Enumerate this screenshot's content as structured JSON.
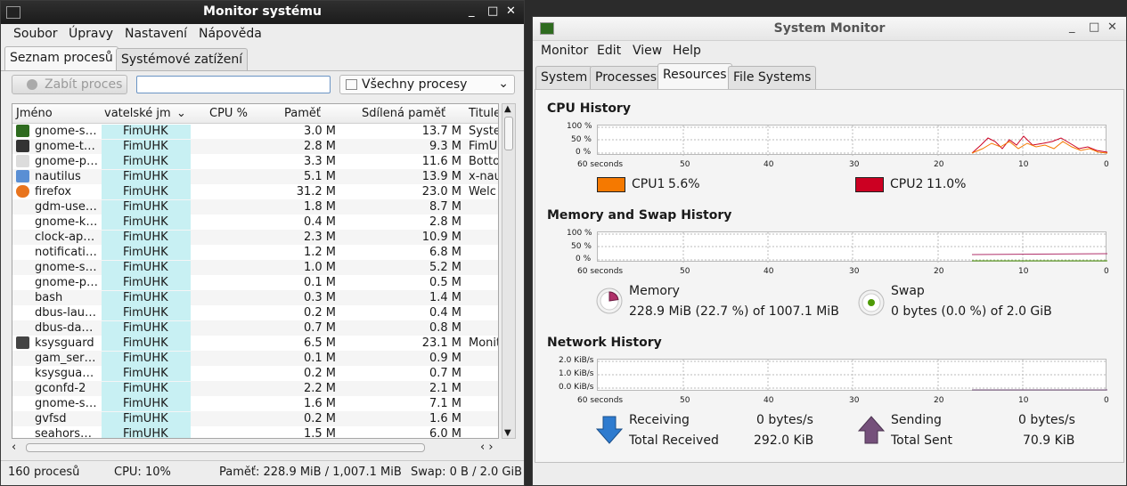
{
  "left_window": {
    "title": "Monitor systému",
    "menu": [
      "Soubor",
      "Úpravy",
      "Nastavení",
      "Nápověda"
    ],
    "tabs": [
      "Seznam procesů",
      "Systémové zatížení"
    ],
    "kill_button": "Zabít proces",
    "search_value": "",
    "filter_value": "Všechny procesy",
    "columns": [
      "Jméno",
      "vatelské jm",
      "CPU %",
      "Paměť",
      "Sdílená paměť",
      "Titule"
    ],
    "processes": [
      {
        "name": "gnome-s…",
        "user": "FimUHK",
        "mem": "3.0 M",
        "shared": "13.7 M",
        "title": "Syste",
        "icon": "monitor-icon"
      },
      {
        "name": "gnome-t…",
        "user": "FimUHK",
        "mem": "2.8 M",
        "shared": "9.3 M",
        "title": "FimU",
        "icon": "terminal-icon"
      },
      {
        "name": "gnome-p…",
        "user": "FimUHK",
        "mem": "3.3 M",
        "shared": "11.6 M",
        "title": "Botto",
        "icon": "panel-icon"
      },
      {
        "name": "nautilus",
        "user": "FimUHK",
        "mem": "5.1 M",
        "shared": "13.9 M",
        "title": "x-nau",
        "icon": "folder-icon"
      },
      {
        "name": "firefox",
        "user": "FimUHK",
        "mem": "31.2 M",
        "shared": "23.0 M",
        "title": "Welc",
        "icon": "firefox-icon"
      },
      {
        "name": "gdm-use…",
        "user": "FimUHK",
        "mem": "1.8 M",
        "shared": "8.7 M",
        "title": "",
        "icon": ""
      },
      {
        "name": "gnome-k…",
        "user": "FimUHK",
        "mem": "0.4 M",
        "shared": "2.8 M",
        "title": "",
        "icon": ""
      },
      {
        "name": "clock-ap…",
        "user": "FimUHK",
        "mem": "2.3 M",
        "shared": "10.9 M",
        "title": "",
        "icon": ""
      },
      {
        "name": "notificati…",
        "user": "FimUHK",
        "mem": "1.2 M",
        "shared": "6.8 M",
        "title": "",
        "icon": ""
      },
      {
        "name": "gnome-s…",
        "user": "FimUHK",
        "mem": "1.0 M",
        "shared": "5.2 M",
        "title": "",
        "icon": ""
      },
      {
        "name": "gnome-p…",
        "user": "FimUHK",
        "mem": "0.1 M",
        "shared": "0.5 M",
        "title": "",
        "icon": ""
      },
      {
        "name": "bash",
        "user": "FimUHK",
        "mem": "0.3 M",
        "shared": "1.4 M",
        "title": "",
        "icon": ""
      },
      {
        "name": "dbus-lau…",
        "user": "FimUHK",
        "mem": "0.2 M",
        "shared": "0.4 M",
        "title": "",
        "icon": ""
      },
      {
        "name": "dbus-da…",
        "user": "FimUHK",
        "mem": "0.7 M",
        "shared": "0.8 M",
        "title": "",
        "icon": ""
      },
      {
        "name": "ksysguard",
        "user": "FimUHK",
        "mem": "6.5 M",
        "shared": "23.1 M",
        "title": "Monit",
        "icon": "ksysguard-icon"
      },
      {
        "name": "gam_ser…",
        "user": "FimUHK",
        "mem": "0.1 M",
        "shared": "0.9 M",
        "title": "",
        "icon": ""
      },
      {
        "name": "ksysgua…",
        "user": "FimUHK",
        "mem": "0.2 M",
        "shared": "0.7 M",
        "title": "",
        "icon": ""
      },
      {
        "name": "gconfd-2",
        "user": "FimUHK",
        "mem": "2.2 M",
        "shared": "2.1 M",
        "title": "",
        "icon": ""
      },
      {
        "name": "gnome-s…",
        "user": "FimUHK",
        "mem": "1.6 M",
        "shared": "7.1 M",
        "title": "",
        "icon": ""
      },
      {
        "name": "gvfsd",
        "user": "FimUHK",
        "mem": "0.2 M",
        "shared": "1.6 M",
        "title": "",
        "icon": ""
      },
      {
        "name": "seahors…",
        "user": "FimUHK",
        "mem": "1.5 M",
        "shared": "6.0 M",
        "title": "",
        "icon": ""
      }
    ],
    "status": {
      "count": "160 procesů",
      "cpu": "CPU: 10%",
      "memory": "Paměť: 228.9 MiB / 1,007.1 MiB",
      "swap": "Swap: 0 B / 2.0 GiB"
    }
  },
  "right_window": {
    "title": "System Monitor",
    "menu": [
      "Monitor",
      "Edit",
      "View",
      "Help"
    ],
    "tabs": [
      "System",
      "Processes",
      "Resources",
      "File Systems"
    ],
    "cpu": {
      "heading": "CPU History",
      "y_ticks": [
        "100 %",
        "50 %",
        "0 %"
      ],
      "x_ticks": [
        "60 seconds",
        "50",
        "40",
        "30",
        "20",
        "10",
        "0"
      ],
      "legend": [
        {
          "label": "CPU1",
          "value": "5.6%",
          "color": "#f57900"
        },
        {
          "label": "CPU2",
          "value": "11.0%",
          "color": "#cc0022"
        }
      ]
    },
    "memory": {
      "heading": "Memory and Swap History",
      "y_ticks": [
        "100 %",
        "50 %",
        "0 %"
      ],
      "x_ticks": [
        "60 seconds",
        "50",
        "40",
        "30",
        "20",
        "10",
        "0"
      ],
      "memory_label": "Memory",
      "memory_value": "228.9 MiB (22.7 %) of 1007.1 MiB",
      "memory_color": "#b0306a",
      "memory_fraction": 0.227,
      "swap_label": "Swap",
      "swap_value": "0 bytes (0.0 %) of 2.0 GiB",
      "swap_color": "#4e9a06",
      "swap_fraction": 0
    },
    "network": {
      "heading": "Network History",
      "y_ticks": [
        "2.0 KiB/s",
        "1.0 KiB/s",
        "0.0 KiB/s"
      ],
      "x_ticks": [
        "60 seconds",
        "50",
        "40",
        "30",
        "20",
        "10",
        "0"
      ],
      "receiving_label": "Receiving",
      "receiving_value": "0 bytes/s",
      "total_received_label": "Total Received",
      "total_received_value": "292.0 KiB",
      "sending_label": "Sending",
      "sending_value": "0 bytes/s",
      "total_sent_label": "Total Sent",
      "total_sent_value": "70.9 KiB",
      "receive_color": "#2e7bcf",
      "send_color": "#75507b"
    }
  }
}
